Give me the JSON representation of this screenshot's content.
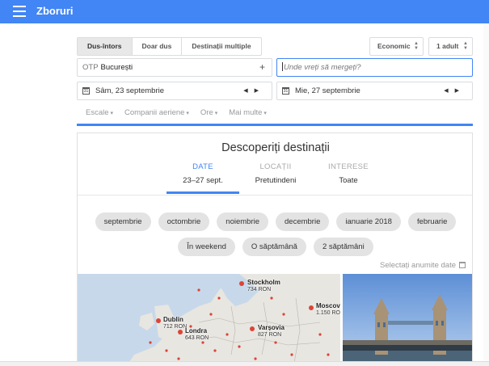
{
  "app": {
    "title": "Zboruri",
    "menu_icon": "hamburger-icon",
    "accent": "#4285f4"
  },
  "search": {
    "trip_types": [
      "Dus-întors",
      "Doar dus",
      "Destinații multiple"
    ],
    "active_trip_type": "Dus-întors",
    "cabin_class": "Economic",
    "passengers": "1 adult",
    "origin_code": "OTP",
    "origin_city": "București",
    "destination_placeholder": "Unde vreți să mergeți?",
    "depart_date": "Sâm, 23 septembrie",
    "return_date": "Mie, 27 septembrie",
    "calendar_icon_text": "31"
  },
  "filters": [
    "Escale",
    "Companii aeriene",
    "Ore",
    "Mai multe"
  ],
  "discover": {
    "title": "Descoperiți destinații",
    "tabs": [
      {
        "heading": "DATE",
        "value": "23–27 sept."
      },
      {
        "heading": "LOCAȚII",
        "value": "Pretutindeni"
      },
      {
        "heading": "INTERESE",
        "value": "Toate"
      }
    ],
    "month_chips": [
      "septembrie",
      "octombrie",
      "noiembrie",
      "decembrie",
      "ianuarie 2018",
      "februarie"
    ],
    "duration_chips": [
      "În weekend",
      "O săptămână",
      "2 săptămâni"
    ],
    "select_dates": "Selectați anumite date"
  },
  "map": {
    "cities": [
      {
        "name": "Stockholm",
        "price": "734 RON"
      },
      {
        "name": "Moscov",
        "price": "1.150 RON"
      },
      {
        "name": "Dublin",
        "price": "712 RON"
      },
      {
        "name": "Londra",
        "price": "643 RON"
      },
      {
        "name": "Varșovia",
        "price": "827 RON"
      }
    ]
  }
}
